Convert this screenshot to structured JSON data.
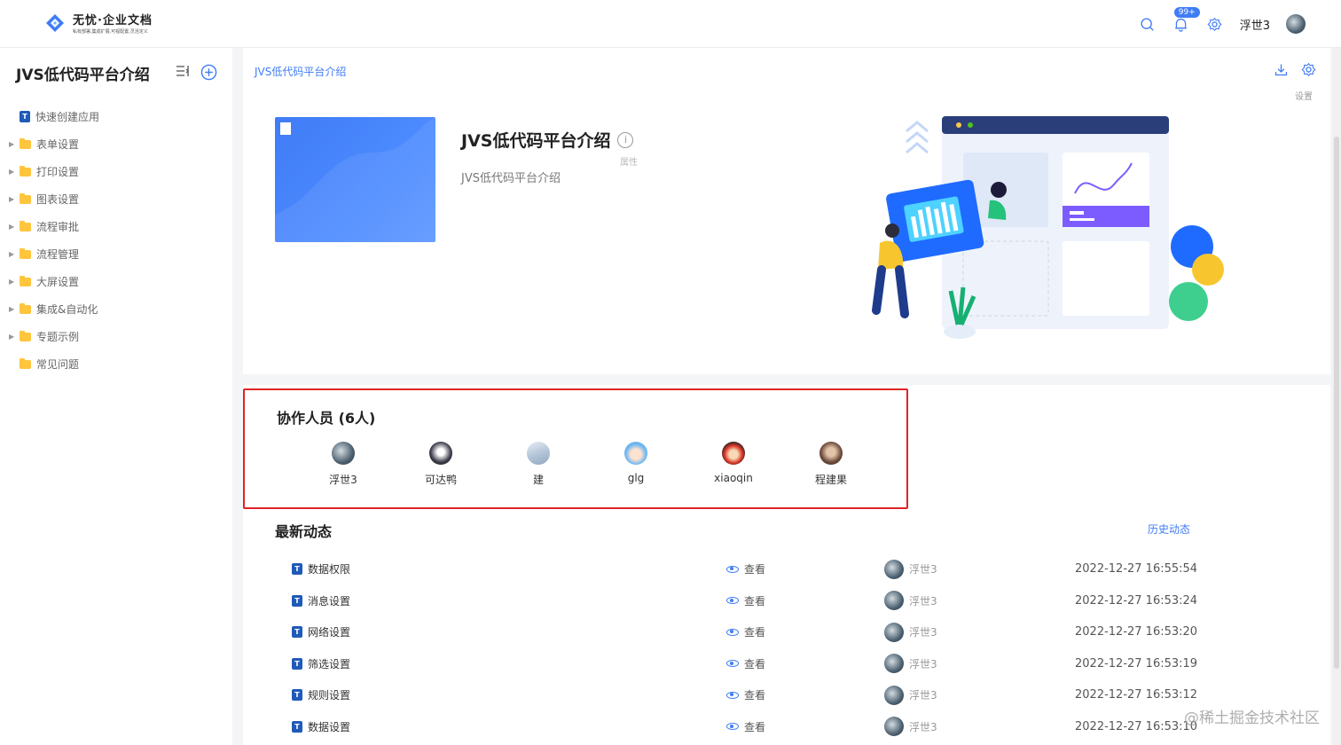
{
  "header": {
    "logo_title": "无忧·企业文档",
    "logo_subtitle": "私有部署,集成扩展,可视配置,灵活定义",
    "notification_count": "99+",
    "username": "浮世3"
  },
  "sidebar": {
    "title": "JVS低代码平台介绍",
    "items": [
      {
        "label": "快速创建应用",
        "type": "doc"
      },
      {
        "label": "表单设置",
        "type": "folder"
      },
      {
        "label": "打印设置",
        "type": "folder"
      },
      {
        "label": "图表设置",
        "type": "folder"
      },
      {
        "label": "流程审批",
        "type": "folder"
      },
      {
        "label": "流程管理",
        "type": "folder"
      },
      {
        "label": "大屏设置",
        "type": "folder"
      },
      {
        "label": "集成&自动化",
        "type": "folder"
      },
      {
        "label": "专题示例",
        "type": "folder"
      },
      {
        "label": "常见问题",
        "type": "folder"
      }
    ]
  },
  "main": {
    "breadcrumb": "JVS低代码平台介绍",
    "settings_tooltip": "设置",
    "doc_title": "JVS低代码平台介绍",
    "doc_subtitle": "JVS低代码平台介绍",
    "attr_tooltip": "属性"
  },
  "collaborators": {
    "title": "协作人员 (6人)",
    "people": [
      {
        "name": "浮世3"
      },
      {
        "name": "可达鸭"
      },
      {
        "name": "建"
      },
      {
        "name": "glg"
      },
      {
        "name": "xiaoqin"
      },
      {
        "name": "程建果"
      }
    ]
  },
  "feed": {
    "title": "最新动态",
    "history_link": "历史动态",
    "rows": [
      {
        "doc": "数据权限",
        "action": "查看",
        "user": "浮世3",
        "time": "2022-12-27 16:55:54"
      },
      {
        "doc": "消息设置",
        "action": "查看",
        "user": "浮世3",
        "time": "2022-12-27 16:53:24"
      },
      {
        "doc": "网络设置",
        "action": "查看",
        "user": "浮世3",
        "time": "2022-12-27 16:53:20"
      },
      {
        "doc": "筛选设置",
        "action": "查看",
        "user": "浮世3",
        "time": "2022-12-27 16:53:19"
      },
      {
        "doc": "规则设置",
        "action": "查看",
        "user": "浮世3",
        "time": "2022-12-27 16:53:12"
      },
      {
        "doc": "数据设置",
        "action": "查看",
        "user": "浮世3",
        "time": "2022-12-27 16:53:10"
      }
    ]
  },
  "watermark": "@稀土掘金技术社区",
  "colors": {
    "accent": "#3f7cf6",
    "highlight_border": "#e02424",
    "folder": "#ffc53d"
  }
}
